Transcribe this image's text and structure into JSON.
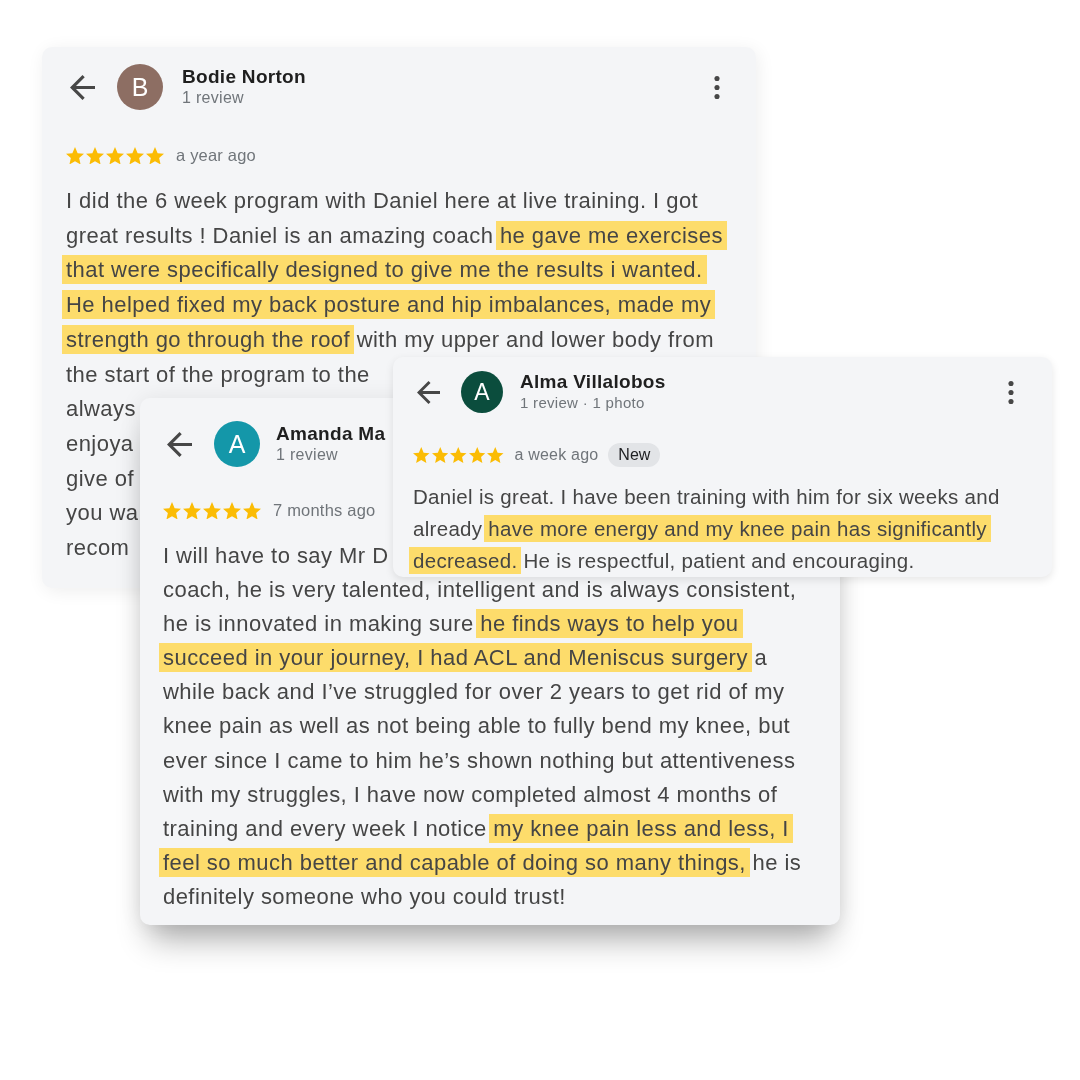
{
  "reviews": [
    {
      "avatar": {
        "letter": "B",
        "color": "#8d6e63"
      },
      "name": "Bodie Norton",
      "meta": "1 review",
      "more_button": true,
      "stars": 5,
      "time": "a year ago",
      "lines": [
        [
          {
            "text": "I did the 6 week program with Daniel here at live training. I got",
            "highlighted": false
          }
        ],
        [
          {
            "text": "great results ! Daniel is an amazing coach ",
            "highlighted": false
          },
          {
            "text": "he gave me exercises",
            "highlighted": true
          }
        ],
        [
          {
            "text": "that were specifically designed to give me the results i wanted.",
            "highlighted": true
          }
        ],
        [
          {
            "text": "He helped fixed my back posture and hip imbalances, made my",
            "highlighted": true
          }
        ],
        [
          {
            "text": "strength go through the roof",
            "highlighted": true
          },
          {
            "text": " with my upper and lower body from",
            "highlighted": false
          }
        ],
        [
          {
            "text": "the start of the program to the",
            "highlighted": false
          }
        ],
        [
          {
            "text": "always",
            "highlighted": false
          }
        ],
        [
          {
            "text": "enjoya",
            "highlighted": false
          }
        ],
        [
          {
            "text": "give of",
            "highlighted": false
          }
        ],
        [
          {
            "text": "you wa",
            "highlighted": false
          }
        ],
        [
          {
            "text": "recom",
            "highlighted": false
          }
        ]
      ]
    },
    {
      "avatar": {
        "letter": "A",
        "color": "#1497a9"
      },
      "name": "Amanda Ma",
      "meta": "1 review",
      "more_button": false,
      "stars": 5,
      "time": "7 months ago",
      "lines": [
        [
          {
            "text": "I will have to say Mr D",
            "highlighted": false
          }
        ],
        [
          {
            "text": "coach, he is very talented, intelligent and is always consistent,",
            "highlighted": false
          }
        ],
        [
          {
            "text": "he is innovated in making sure ",
            "highlighted": false
          },
          {
            "text": "he finds ways to help you",
            "highlighted": true
          }
        ],
        [
          {
            "text": "succeed in your journey, I had ACL and Meniscus surgery",
            "highlighted": true
          },
          {
            "text": " a",
            "highlighted": false
          }
        ],
        [
          {
            "text": "while back and I’ve struggled for over 2 years to get rid of my",
            "highlighted": false
          }
        ],
        [
          {
            "text": "knee pain as well as not being able to fully bend my knee, but",
            "highlighted": false
          }
        ],
        [
          {
            "text": "ever since I came to him he’s shown nothing but attentiveness",
            "highlighted": false
          }
        ],
        [
          {
            "text": "with my struggles, I have now completed almost 4 months of",
            "highlighted": false
          }
        ],
        [
          {
            "text": "training and every week I notice ",
            "highlighted": false
          },
          {
            "text": "my knee pain less and less, I",
            "highlighted": true
          }
        ],
        [
          {
            "text": "feel so much better and capable of doing so many things,",
            "highlighted": true
          },
          {
            "text": " he is",
            "highlighted": false
          }
        ],
        [
          {
            "text": "definitely someone who you could trust!",
            "highlighted": false
          }
        ]
      ]
    },
    {
      "avatar": {
        "letter": "A",
        "color": "#0b4d3d"
      },
      "name": "Alma Villalobos",
      "meta": "1 review · 1 photo",
      "more_button": true,
      "stars": 5,
      "time": "a week ago",
      "badge": "New",
      "lines": [
        [
          {
            "text": "Daniel is great. I have been training with him for six weeks and",
            "highlighted": false
          }
        ],
        [
          {
            "text": "already ",
            "highlighted": false
          },
          {
            "text": "have more energy and my knee pain has significantly",
            "highlighted": true
          }
        ],
        [
          {
            "text": "decreased.",
            "highlighted": true
          },
          {
            "text": " He is respectful, patient and encouraging.",
            "highlighted": false
          }
        ]
      ]
    }
  ]
}
